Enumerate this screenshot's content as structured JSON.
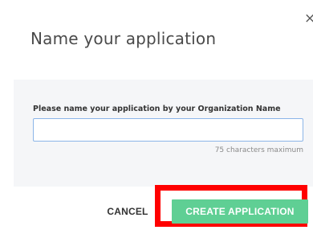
{
  "dialog": {
    "title": "Name your application",
    "close_icon": "close-icon",
    "close_glyph": "×"
  },
  "form": {
    "label": "Please name your application by your Organization Name",
    "input_value": "",
    "input_placeholder": "",
    "helper_text": "75 characters maximum"
  },
  "actions": {
    "cancel_label": "CANCEL",
    "create_label": "CREATE APPLICATION"
  },
  "colors": {
    "primary_button": "#5fcf94",
    "highlight": "#ff0000",
    "panel_background": "#f5f6f8",
    "input_border": "#8bb5e8"
  }
}
